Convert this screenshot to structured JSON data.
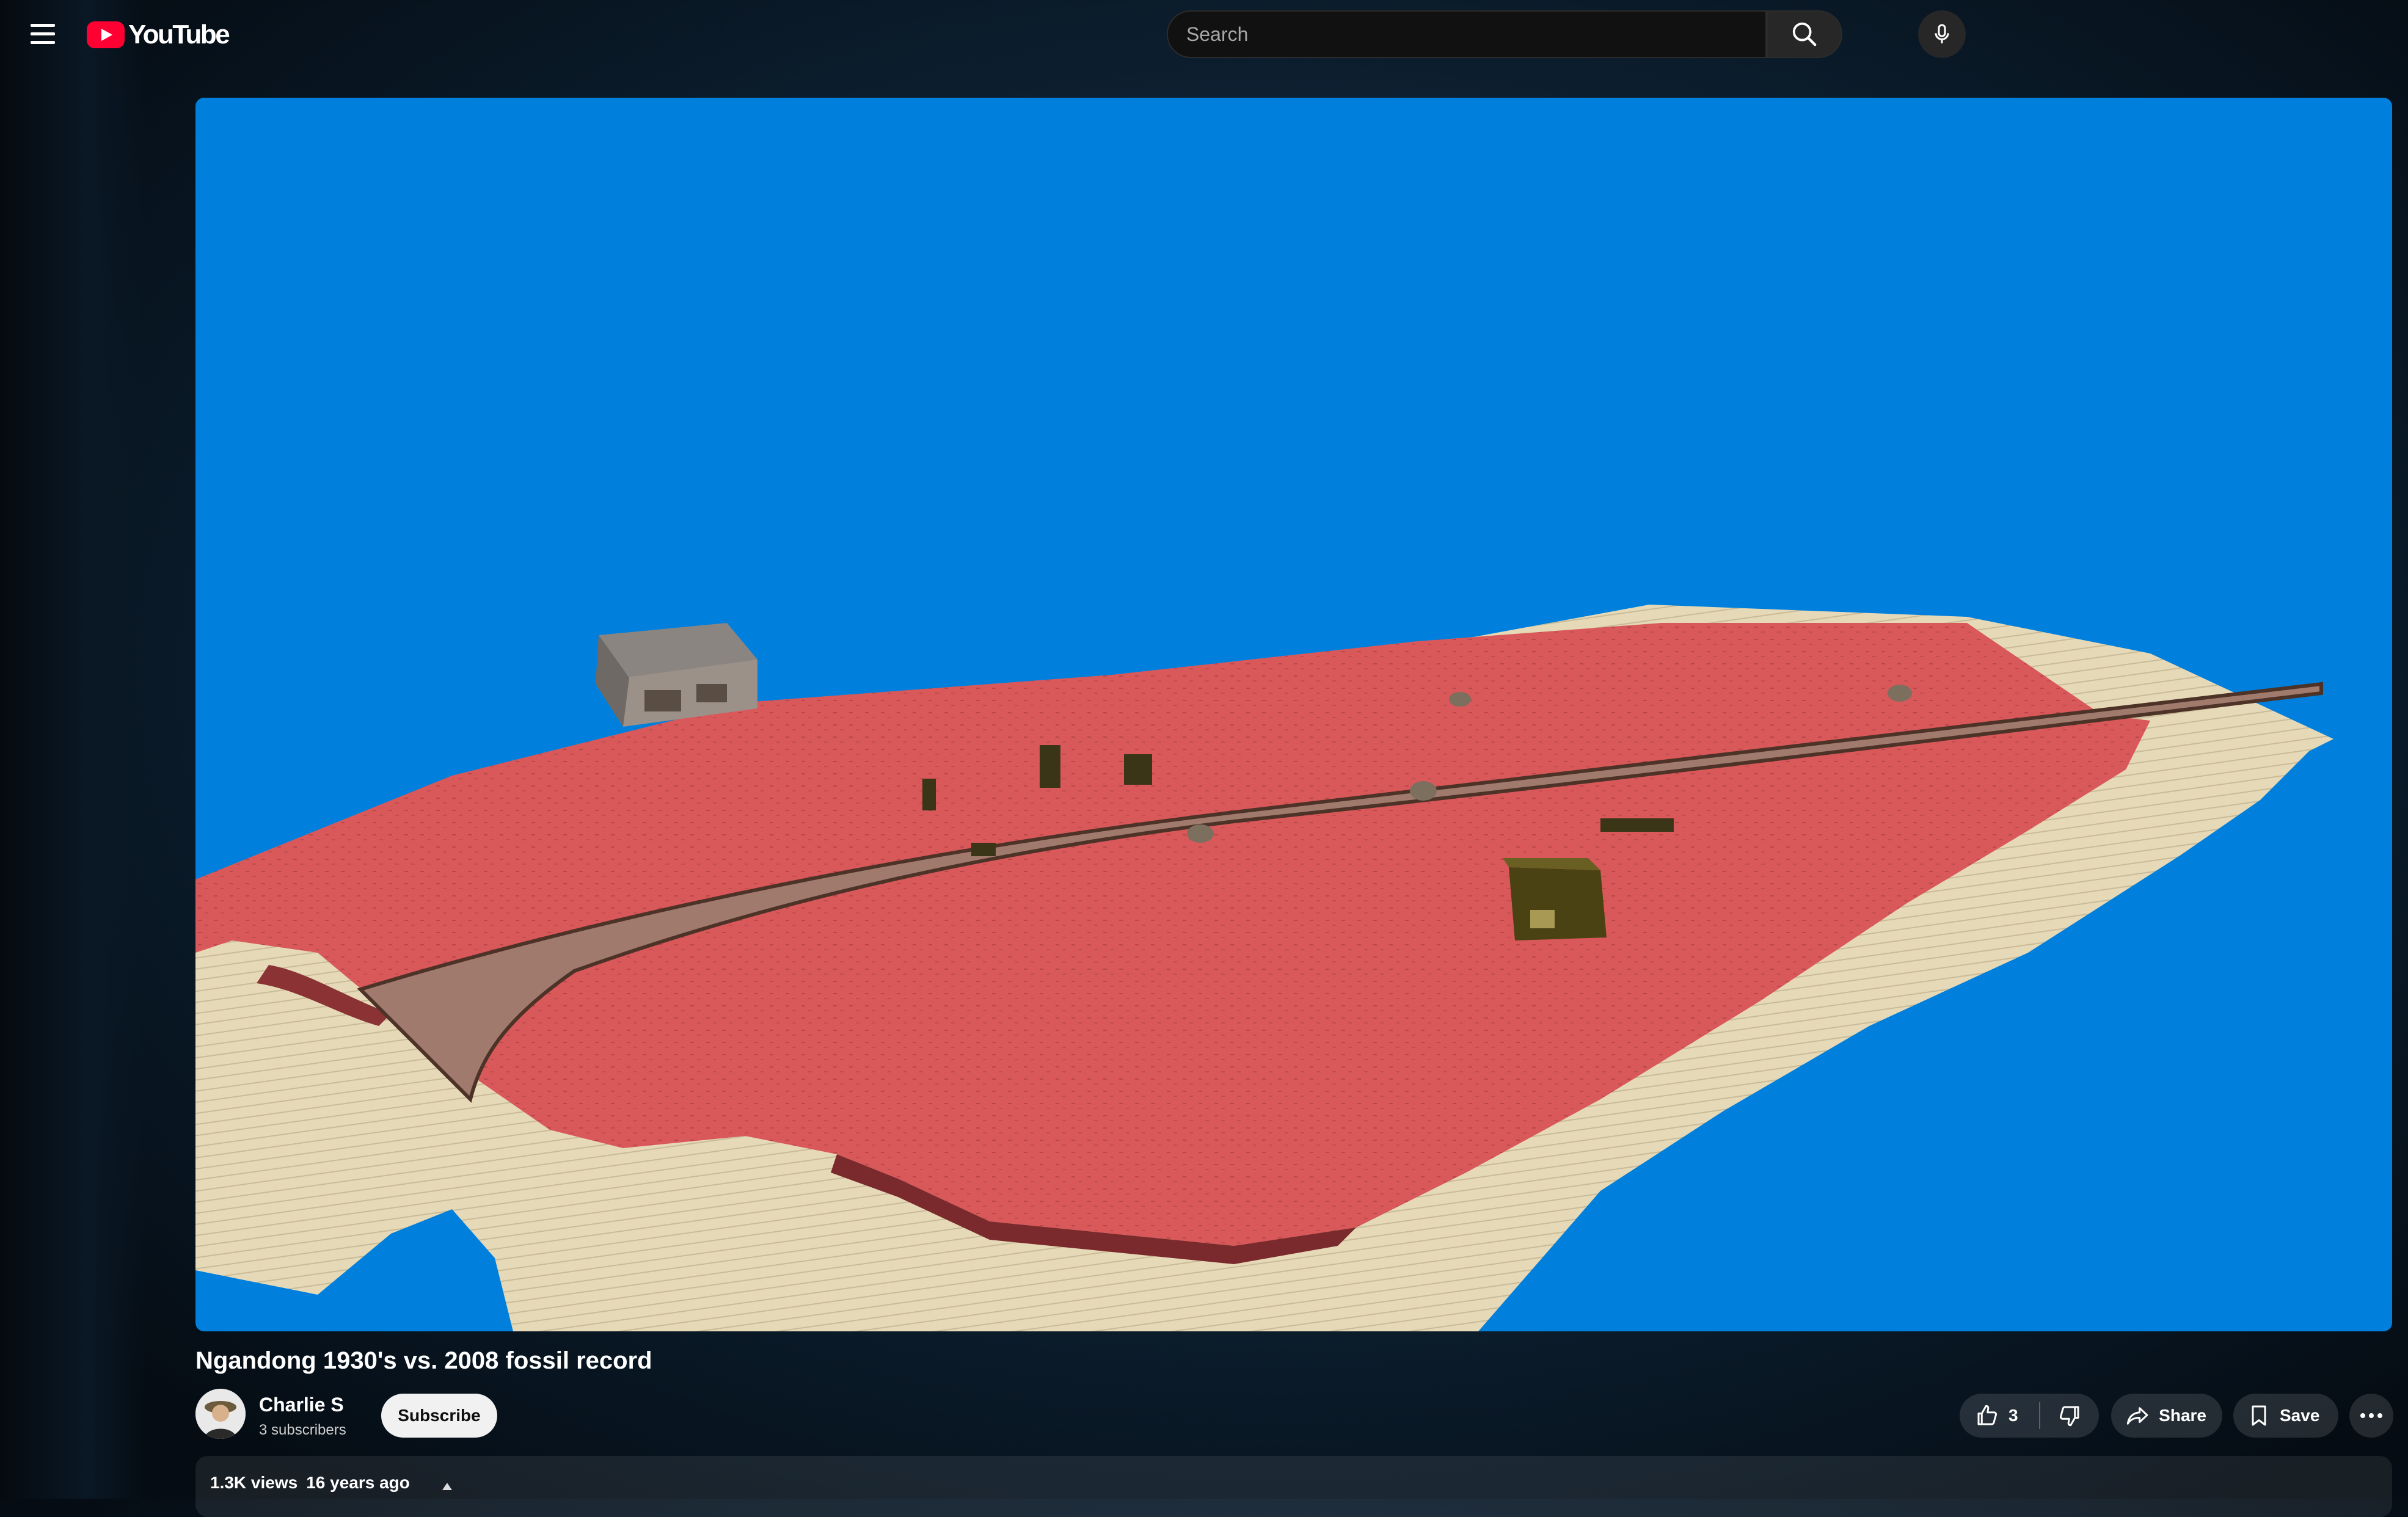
{
  "header": {
    "logo_text": "YouTube",
    "search_placeholder": "Search",
    "menu_icon": "hamburger-menu-icon",
    "search_icon": "search-icon",
    "mic_icon": "microphone-icon"
  },
  "video": {
    "title": "Ngandong 1930's vs. 2008 fossil record",
    "background_color": "#0080dc",
    "terrain_color": "#d9585a",
    "sand_color": "#e6d9b8"
  },
  "channel": {
    "name": "Charlie S",
    "subscribers": "3 subscribers",
    "subscribe_label": "Subscribe"
  },
  "actions": {
    "like_count": "3",
    "share_label": "Share",
    "save_label": "Save"
  },
  "description": {
    "views": "1.3K views",
    "age": "16 years ago"
  },
  "colors": {
    "brand_red": "#ff0033",
    "subscribe_bg": "#f1f1f1"
  }
}
